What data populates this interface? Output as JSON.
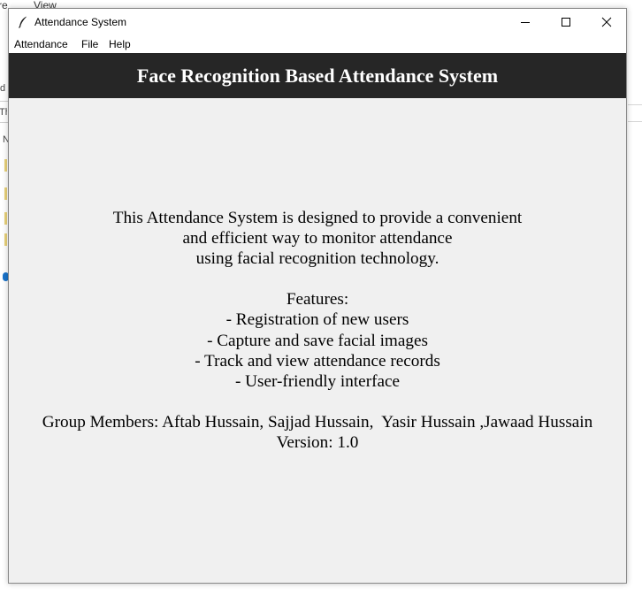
{
  "background_app": {
    "menu_fragments": [
      "re",
      "View"
    ],
    "edge_fragments": [
      "d",
      "Th",
      "N"
    ]
  },
  "window": {
    "title": "Attendance System",
    "icon": "feather-icon",
    "controls": {
      "minimize": "minimize-icon",
      "maximize": "maximize-icon",
      "close": "close-icon"
    }
  },
  "menu": {
    "items": [
      "Attendance",
      "File",
      "Help"
    ]
  },
  "header": {
    "title": "Face Recognition Based Attendance System",
    "background": "#262626",
    "color": "#ffffff"
  },
  "about": {
    "intro": [
      "This Attendance System is designed to provide a convenient",
      "and efficient way to monitor attendance",
      "using facial recognition technology."
    ],
    "features_heading": "Features:",
    "features": [
      "- Registration of new users",
      "- Capture and save facial images",
      "- Track and view attendance records",
      "- User-friendly interface"
    ],
    "group_members": "Group Members: Aftab Hussain, Sajjad Hussain,  Yasir Hussain ,Jawaad Hussain",
    "version": "Version: 1.0"
  }
}
